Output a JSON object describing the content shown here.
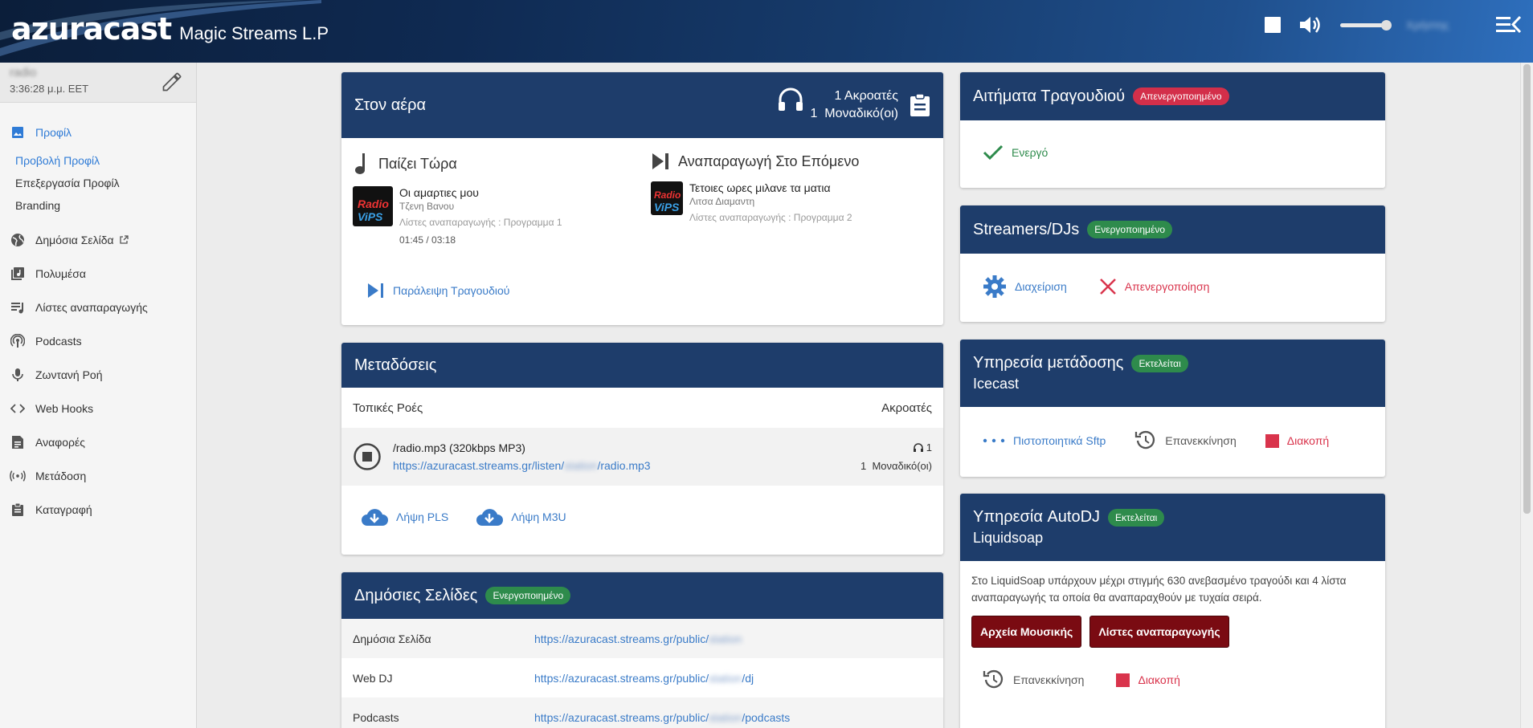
{
  "brand": {
    "logo": "azuracast",
    "station": "Magic Streams L.P"
  },
  "header": {
    "user_name": "Χρήστης"
  },
  "sidebar": {
    "station_name": "radio",
    "station_time": "3:36:28 μ.μ. EET",
    "profile_label": "Προφίλ",
    "subitems": [
      "Προβολή Προφίλ",
      "Επεξεργασία Προφίλ",
      "Branding"
    ],
    "items": [
      "Δημόσια Σελίδα",
      "Πολυμέσα",
      "Λίστες αναπαραγωγής",
      "Podcasts",
      "Ζωντανή Ροή",
      "Web Hooks",
      "Αναφορές",
      "Μετάδοση",
      "Καταγραφή"
    ]
  },
  "now_playing": {
    "title": "Στον αέρα",
    "listeners_count": "1 Ακροατές",
    "unique_count": "1",
    "unique_label": "Μοναδικό(οι)",
    "playing_now_label": "Παίζει Τώρα",
    "playing_next_label": "Αναπαραγωγή Στο Επόμενο",
    "current": {
      "title": "Οι αμαρτιες μου",
      "artist": "Τζενη Βανου",
      "playlist": "Λίστες αναπαραγωγής : Προγραμμα 1",
      "time": "01:45 / 03:18"
    },
    "next": {
      "title": "Τετοιες ωρες μιλανε τα ματια",
      "artist": "Λιτσα Διαμαντη",
      "playlist": "Λίστες αναπαραγωγής : Προγραμμα 2"
    },
    "art_text_a": "Radio",
    "art_text_b": "ViPS",
    "skip_label": "Παράλειψη Τραγουδιού"
  },
  "broadcasts": {
    "title": "Μεταδόσεις",
    "col_left": "Τοπικές Ροές",
    "col_right": "Ακροατές",
    "stream_name": "/radio.mp3 (320kbps MP3)",
    "stream_url_prefix": "https://azuracast.streams.gr/listen/",
    "stream_url_hidden": "station",
    "stream_url_suffix": "/radio.mp3",
    "stream_listeners": "1",
    "stream_unique_count": "1",
    "stream_unique_label": "Μοναδικό(οι)",
    "download_pls": "Λήψη PLS",
    "download_m3u": "Λήψη M3U"
  },
  "public_pages": {
    "title": "Δημόσιες Σελίδες",
    "badge": "Ενεργοποιημένο",
    "rows": [
      {
        "label": "Δημόσια Σελίδα",
        "url_prefix": "https://azuracast.streams.gr/public/",
        "url_hidden": "station",
        "url_suffix": ""
      },
      {
        "label": "Web DJ",
        "url_prefix": "https://azuracast.streams.gr/public/",
        "url_hidden": "station",
        "url_suffix": "/dj"
      },
      {
        "label": "Podcasts",
        "url_prefix": "https://azuracast.streams.gr/public/",
        "url_hidden": "station",
        "url_suffix": "/podcasts"
      }
    ]
  },
  "requests": {
    "title": "Αιτήματα Τραγουδιού",
    "badge": "Απενεργοποιημένο",
    "action": "Ενεργό"
  },
  "streamers": {
    "title": "Streamers/DJs",
    "badge": "Ενεργοποιημένο",
    "manage": "Διαχείριση",
    "disable": "Απενεργοποίηση"
  },
  "broadcast_service": {
    "title": "Υπηρεσία μετάδοσης",
    "badge": "Εκτελείται",
    "name": "Icecast",
    "sftp": "Πιστοποιητικά Sftp",
    "restart": "Επανεκκίνηση",
    "stop": "Διακοπή"
  },
  "autodj": {
    "title": "Υπηρεσία AutoDJ",
    "badge": "Εκτελείται",
    "name": "Liquidsoap",
    "description": "Στο LiquidSoap υπάρχουν μέχρι στιγμής 630 ανεβασμένο τραγούδι και 4 λίστα αναπαραγωγής τα οποία θα αναπαραχθούν με τυχαία σειρά.",
    "btn_music": "Αρχεία Μουσικής",
    "btn_playlists": "Λίστες αναπαραγωγής",
    "restart": "Επανεκκίνηση",
    "stop": "Διακοπή"
  },
  "colors": {
    "header_blue": "#1e3d6b",
    "accent": "#2f7bd6",
    "danger": "#d9344c",
    "success": "#2e8b4c"
  }
}
